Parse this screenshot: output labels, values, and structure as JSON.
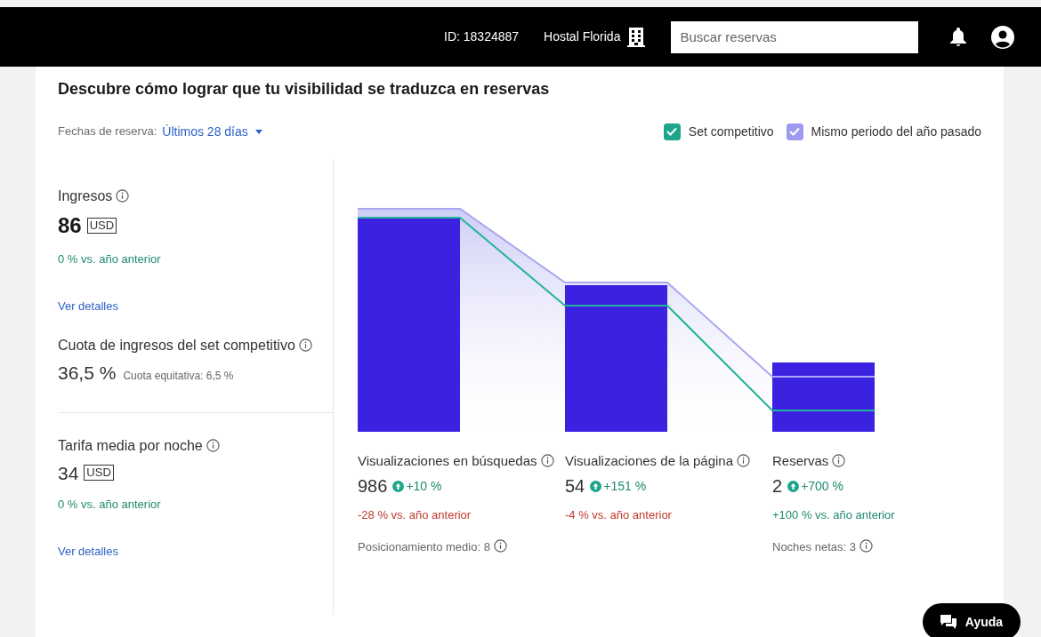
{
  "topbar": {
    "account_id": "ID: 18324887",
    "property": "Hostal Florida",
    "search": {
      "placeholder": "Buscar reservas"
    }
  },
  "heading": "Descubre cómo lograr que tu visibilidad se traduzca en reservas",
  "date_filter": {
    "label": "Fechas de reserva:",
    "value": "Últimos 28 días"
  },
  "legend": [
    {
      "label": "Set competitivo",
      "checked": true,
      "color": "#1fa58c"
    },
    {
      "label": "Mismo periodo del año pasado",
      "checked": true,
      "color": "#9d9af0"
    }
  ],
  "left_metrics": [
    {
      "kind": "money",
      "title": "Ingresos",
      "value": "86",
      "unit": "USD",
      "emphasized": true,
      "change": "0 % vs. año anterior",
      "negative": false,
      "link": "Ver detalles"
    },
    {
      "kind": "share",
      "title": "Cuota de ingresos del set competitivo",
      "value": "36,5 %",
      "note": "Cuota equitativa: 6,5 %"
    },
    {
      "kind": "money",
      "title": "Tarifa media por noche",
      "value": "34",
      "unit": "USD",
      "emphasized": false,
      "change": "0 % vs. año anterior",
      "negative": false,
      "link": "Ver detalles"
    }
  ],
  "funnel": [
    {
      "title": "Visualizaciones en búsquedas",
      "value": "986",
      "badge": "+10 %",
      "yoy": "-28 % vs. año anterior",
      "negative": true,
      "extra": "Posicionamiento medio: 8"
    },
    {
      "title": "Visualizaciones de la página",
      "value": "54",
      "badge": "+151 %",
      "yoy": "-4 % vs. año anterior",
      "negative": true
    },
    {
      "title": "Reservas",
      "value": "2",
      "badge": "+700 %",
      "yoy": "+100 % vs. año anterior",
      "negative": false,
      "extra": "Noches netas: 3"
    }
  ],
  "help_button": "Ayuda"
}
